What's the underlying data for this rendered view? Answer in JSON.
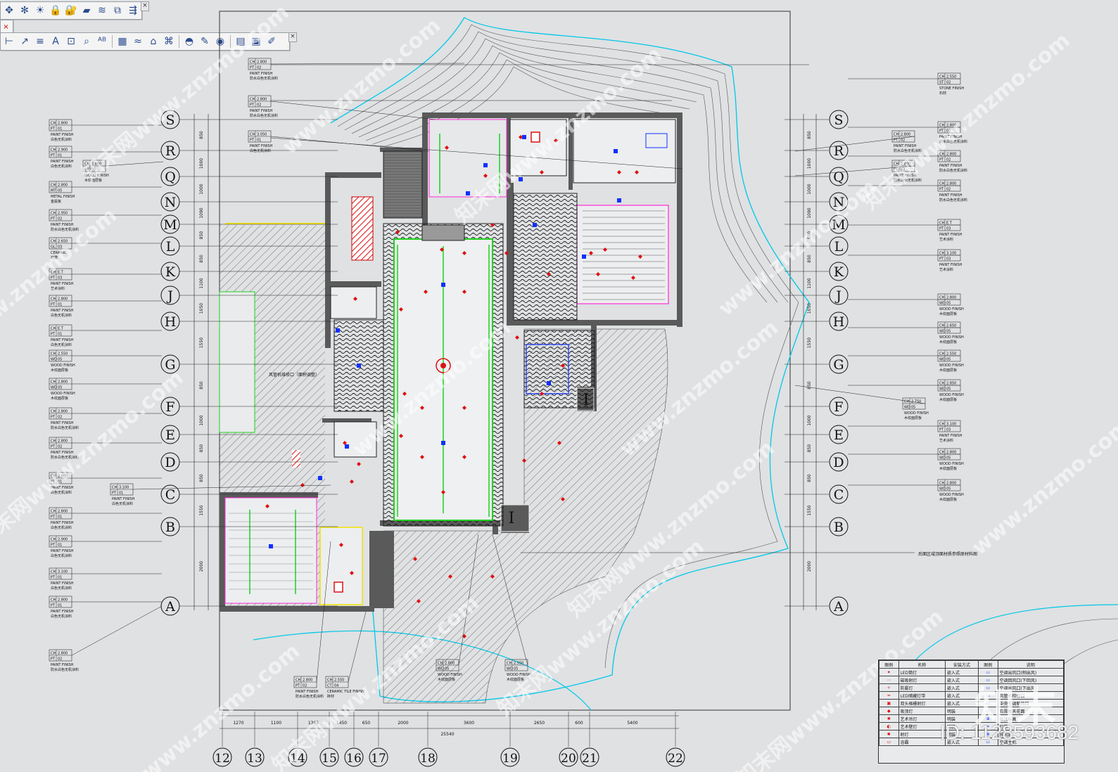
{
  "toolbars": {
    "top": [
      "match-props-icon",
      "settings-icon",
      "light-icon",
      "lock-icon",
      "layer-lock-icon",
      "layer-isolate-icon",
      "layer-stack-icon",
      "layer-merge-icon",
      "layer-walk-icon"
    ],
    "middle": [
      "close-icon"
    ],
    "annotate": [
      "dim-linear-icon",
      "leader-icon",
      "text-align-icon",
      "text-icon",
      "text-box-icon",
      "text-find-icon",
      "text-edit-icon",
      "table-icon",
      "wave-icon",
      "house-icon",
      "building-icon",
      "hat-icon",
      "pen-icon",
      "eye-icon",
      "grid-view-icon",
      "frame-icon",
      "brush-icon"
    ],
    "close_label": "×"
  },
  "axes": {
    "rows": [
      "S",
      "R",
      "Q",
      "N",
      "M",
      "L",
      "K",
      "J",
      "H",
      "G",
      "F",
      "E",
      "D",
      "C",
      "B",
      "A"
    ],
    "columns": [
      "12",
      "13",
      "14",
      "15",
      "16",
      "17",
      "18",
      "19",
      "20",
      "21",
      "22"
    ]
  },
  "dimensions": {
    "bottom": [
      "1270",
      "1100",
      "1365",
      "1450",
      "650",
      "2000",
      "3600",
      "2650",
      "600",
      "5400"
    ],
    "total": "25540",
    "left": [
      "850",
      "1000",
      "1000",
      "1090",
      "850",
      "850",
      "1100",
      "1050",
      "1550",
      "850",
      "1000",
      "850",
      "850",
      "1550",
      "2000"
    ]
  },
  "left_tags": [
    {
      "code1": "CH",
      "val1": "2.800",
      "code2": "PT",
      "val2": "01",
      "en": "PAINT FINISH",
      "zh": "白色无机涂料"
    },
    {
      "code1": "CH",
      "val1": "2.900",
      "code2": "PT",
      "val2": "01",
      "en": "PAINT FINISH",
      "zh": "白色无机涂料"
    },
    {
      "code1": "CH",
      "val1": "2.800",
      "code2": "MT",
      "val2": "05",
      "en": "METAL FINISH",
      "zh": "金属板"
    },
    {
      "code1": "CH",
      "val1": "2.950",
      "code2": "PT",
      "val2": "02",
      "en": "PAINT FINISH",
      "zh": "防水白色无机涂料"
    },
    {
      "code1": "CH",
      "val1": "2.650",
      "code2": "GL",
      "val2": "03",
      "en": "CERAMIC",
      "zh": "灯膜"
    },
    {
      "code1": "CH",
      "val1": "E.T",
      "val2": "03",
      "code2": "PT",
      "en": "PAINT FINISH",
      "zh": "艺术涂料"
    },
    {
      "code1": "CH",
      "val1": "2.800",
      "code2": "PT",
      "val2": "01",
      "en": "PAINT FINISH",
      "zh": "白色无机涂料"
    },
    {
      "code1": "CH",
      "val1": "E.T",
      "code2": "PT",
      "val2": "01",
      "en": "PAINT FINISH",
      "zh": "白色无机涂料"
    },
    {
      "code1": "CH",
      "val1": "2.550",
      "code2": "WD",
      "val2": "05",
      "en": "WOOD FINISH",
      "zh": "木纹面层板"
    },
    {
      "code1": "CH",
      "val1": "2.800",
      "code2": "WD",
      "val2": "05",
      "en": "WOOD FINISH",
      "zh": "木纹面层板"
    },
    {
      "code1": "CH",
      "val1": "2.800",
      "code2": "PT",
      "val2": "02",
      "en": "PAINT FINISH",
      "zh": "防水白色无机涂料"
    },
    {
      "code1": "CH",
      "val1": "2.800",
      "code2": "PT",
      "val2": "02",
      "en": "PAINT FINISH",
      "zh": "防水白色无机涂料"
    },
    {
      "code1": "CH",
      "val1": "2.800",
      "code2": "PT",
      "val2": "01",
      "en": "PAINT FINISH",
      "zh": "白色无机涂料"
    },
    {
      "code1": "CH",
      "val1": "2.800",
      "code2": "PT",
      "val2": "01",
      "en": "PAINT FINISH",
      "zh": "白色无机涂料"
    },
    {
      "code1": "CH",
      "val1": "2.900",
      "code2": "PT",
      "val2": "01",
      "en": "PAINT FINISH",
      "zh": "白色无机涂料"
    },
    {
      "code1": "CH",
      "val1": "3.100",
      "code2": "PT",
      "val2": "01",
      "en": "PAINT FINISH",
      "zh": "白色无机涂料"
    },
    {
      "code1": "CH",
      "val1": "2.800",
      "code2": "PT",
      "val2": "01",
      "en": "PAINT FINISH",
      "zh": "白色无机涂料"
    },
    {
      "code1": "CH",
      "val1": "2.800",
      "code2": "PT",
      "val2": "02",
      "en": "PAINT FINISH",
      "zh": "防水白色无机涂料"
    }
  ],
  "right_tags": [
    {
      "code1": "CH",
      "val1": "2.550",
      "code2": "ST",
      "val2": "02",
      "en": "STONE FINISH",
      "zh": "石材"
    },
    {
      "code1": "CH",
      "val1": "2.800",
      "code2": "PT",
      "val2": "02",
      "en": "PAINT FINISH",
      "zh": "防水白色无机涂料"
    },
    {
      "code1": "CH",
      "val1": "2.800",
      "code2": "PT",
      "val2": "02",
      "en": "PAINT FINISH",
      "zh": "防水白色无机涂料"
    },
    {
      "code1": "CH",
      "val1": "2.800",
      "code2": "PT",
      "val2": "02",
      "en": "PAINT FINISH",
      "zh": "防水白色无机涂料"
    },
    {
      "code1": "CH",
      "val1": "E.T",
      "code2": "PT",
      "val2": "03",
      "en": "PAINT FINISH",
      "zh": "艺术涂料"
    },
    {
      "code1": "CH",
      "val1": "3.100",
      "code2": "PT",
      "val2": "03",
      "en": "PAINT FINISH",
      "zh": "艺术涂料"
    },
    {
      "code1": "CH",
      "val1": "2.800",
      "code2": "WD",
      "val2": "05",
      "en": "WOOD FINISH",
      "zh": "木纹面层板"
    },
    {
      "code1": "CH",
      "val1": "2.650",
      "code2": "WD",
      "val2": "05",
      "en": "WOOD FINISH",
      "zh": "木纹面层板"
    },
    {
      "code1": "CH",
      "val1": "2.550",
      "code2": "WD",
      "val2": "05",
      "en": "WOOD FINISH",
      "zh": "木纹面层板"
    },
    {
      "code1": "CH",
      "val1": "2.850",
      "code2": "WD",
      "val2": "05",
      "en": "WOOD FINISH",
      "zh": "木纹面层板"
    },
    {
      "code1": "CH",
      "val1": "3.100",
      "code2": "PT",
      "val2": "03",
      "en": "PAINT FINISH",
      "zh": "艺术涂料"
    },
    {
      "code1": "CH",
      "val1": "2.800",
      "code2": "WD",
      "val2": "05",
      "en": "WOOD FINISH",
      "zh": "木纹面层板"
    },
    {
      "code1": "CH",
      "val1": "2.800",
      "code2": "WD",
      "val2": "05",
      "en": "WOOD FINISH",
      "zh": "木纹面层板"
    }
  ],
  "mid_tags": [
    {
      "code1": "CH",
      "val1": "2.800",
      "code2": "PT",
      "val2": "02",
      "en": "PAINT FINISH",
      "zh": "防水白色无机涂料"
    },
    {
      "code1": "CH",
      "val1": "2.800",
      "code2": "PT",
      "val2": "02",
      "en": "PAINT FINISH",
      "zh": "防水白色无机涂料"
    },
    {
      "code1": "CH",
      "val1": "3.050",
      "code2": "PT",
      "val2": "01",
      "en": "PAINT FINISH",
      "zh": "白色无机涂料"
    },
    {
      "code1": "CH",
      "val1": "2.800",
      "code2": "PT",
      "val2": "02",
      "en": "PAINT FINISH",
      "zh": "防水白色无机涂料"
    },
    {
      "code1": "CH",
      "val1": "2.550",
      "code2": "CT",
      "val2": "04",
      "en": "CERAMIC TILE FINISH",
      "zh": "砖材"
    },
    {
      "code1": "CH",
      "val1": "2.800",
      "code2": "WD",
      "val2": "05",
      "en": "WOOD FINISH",
      "zh": "木纹面层板"
    },
    {
      "code1": "CH",
      "val1": "2.550",
      "code2": "WD",
      "val2": "05",
      "en": "WOOD FINISH",
      "zh": "木纹面层板"
    },
    {
      "code1": "CH",
      "val1": "3.100",
      "code2": "PT",
      "val2": "01",
      "en": "PAINT FINISH",
      "zh": "白色无机涂料"
    },
    {
      "code1": "CH",
      "val1": "2.800",
      "code2": "PT",
      "val2": "02",
      "en": "PAINT FINISH",
      "zh": "防水白色无机涂料"
    },
    {
      "code1": "CH",
      "val1": "2.800",
      "code2": "PT",
      "val2": "02",
      "en": "PAINT FINISH",
      "zh": "防水白色无机涂料"
    },
    {
      "code1": "CH",
      "val1": "2.750",
      "code2": "WD",
      "val2": "05",
      "en": "WOOD FINISH",
      "zh": "木纹面层板"
    },
    {
      "code1": "CH",
      "val1": "2.800",
      "code2": "WD",
      "val2": "05",
      "en": "WOOD FINISH",
      "zh": "木纹面层板"
    }
  ],
  "notes": {
    "center": "风管机维修口（面积调整）",
    "right": "后面区域顶面材质参照原材料图"
  },
  "legend": {
    "headers": [
      "图例",
      "名称",
      "安装方式",
      "图例",
      "说明"
    ],
    "rows": [
      [
        "",
        "LED筒灯",
        "嵌入式",
        "",
        "空调出风口(侧出风)"
      ],
      [
        "",
        "磁吸射灯",
        "嵌入式",
        "",
        "空调回风口(下回风)"
      ],
      [
        "",
        "防雾灯",
        "嵌入式",
        "",
        "空调出风口(下出风)"
      ],
      [
        "",
        "LED暗藏灯带",
        "嵌入式",
        "",
        "风管机检修口"
      ],
      [
        "",
        "双头格栅射灯",
        "嵌入式",
        "",
        "中央空调新风口"
      ],
      [
        "",
        "吸顶灯",
        "明装",
        "",
        "石膏板天花面"
      ],
      [
        "",
        "艺术吊灯",
        "明装",
        "",
        "吊顶标高"
      ],
      [
        "",
        "艺术壁灯",
        "明装",
        "",
        "灯带"
      ],
      [
        "",
        "射灯",
        "明装",
        "",
        "排风扇"
      ],
      [
        "",
        "浴霸",
        "嵌入式",
        "",
        "空调主机"
      ]
    ]
  },
  "watermark": {
    "site": "www.znzmo.com",
    "brand": "知末网",
    "logo": "知末",
    "id": "ID: 1128593682"
  },
  "colors": {
    "wall": "#5a5a5a",
    "cyan": "#00c8e6",
    "green": "#1fd11f",
    "magenta": "#ff2ad4",
    "red": "#e01010",
    "blue": "#1030ff",
    "yellow": "#f1e200"
  }
}
